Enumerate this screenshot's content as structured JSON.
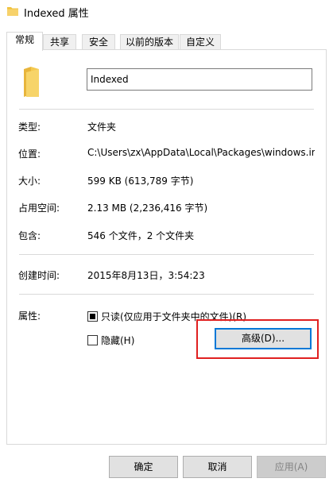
{
  "window": {
    "title": "Indexed 属性"
  },
  "tabs": [
    {
      "label": "常规",
      "active": true
    },
    {
      "label": "共享",
      "active": false
    },
    {
      "label": "安全",
      "active": false
    },
    {
      "label": "以前的版本",
      "active": false
    },
    {
      "label": "自定义",
      "active": false
    }
  ],
  "general": {
    "name": "Indexed",
    "type_label": "类型:",
    "type_value": "文件夹",
    "location_label": "位置:",
    "location_value": "C:\\Users\\zx\\AppData\\Local\\Packages\\windows.im",
    "size_label": "大小:",
    "size_value": "599 KB (613,789 字节)",
    "size_on_disk_label": "占用空间:",
    "size_on_disk_value": "2.13 MB (2,236,416 字节)",
    "contains_label": "包含:",
    "contains_value": "546 个文件，2 个文件夹",
    "created_label": "创建时间:",
    "created_value": "2015年8月13日，3:54:23",
    "attributes_label": "属性:",
    "readonly_label": "只读(仅应用于文件夹中的文件)(R)",
    "readonly_state": "indeterminate",
    "hidden_label": "隐藏(H)",
    "hidden_checked": false,
    "advanced_label": "高级(D)..."
  },
  "footer": {
    "ok_label": "确定",
    "cancel_label": "取消",
    "apply_label": "应用(A)"
  },
  "colors": {
    "highlight": "#e02020",
    "focus_border": "#0078d7",
    "folder": "#f0c23b"
  }
}
